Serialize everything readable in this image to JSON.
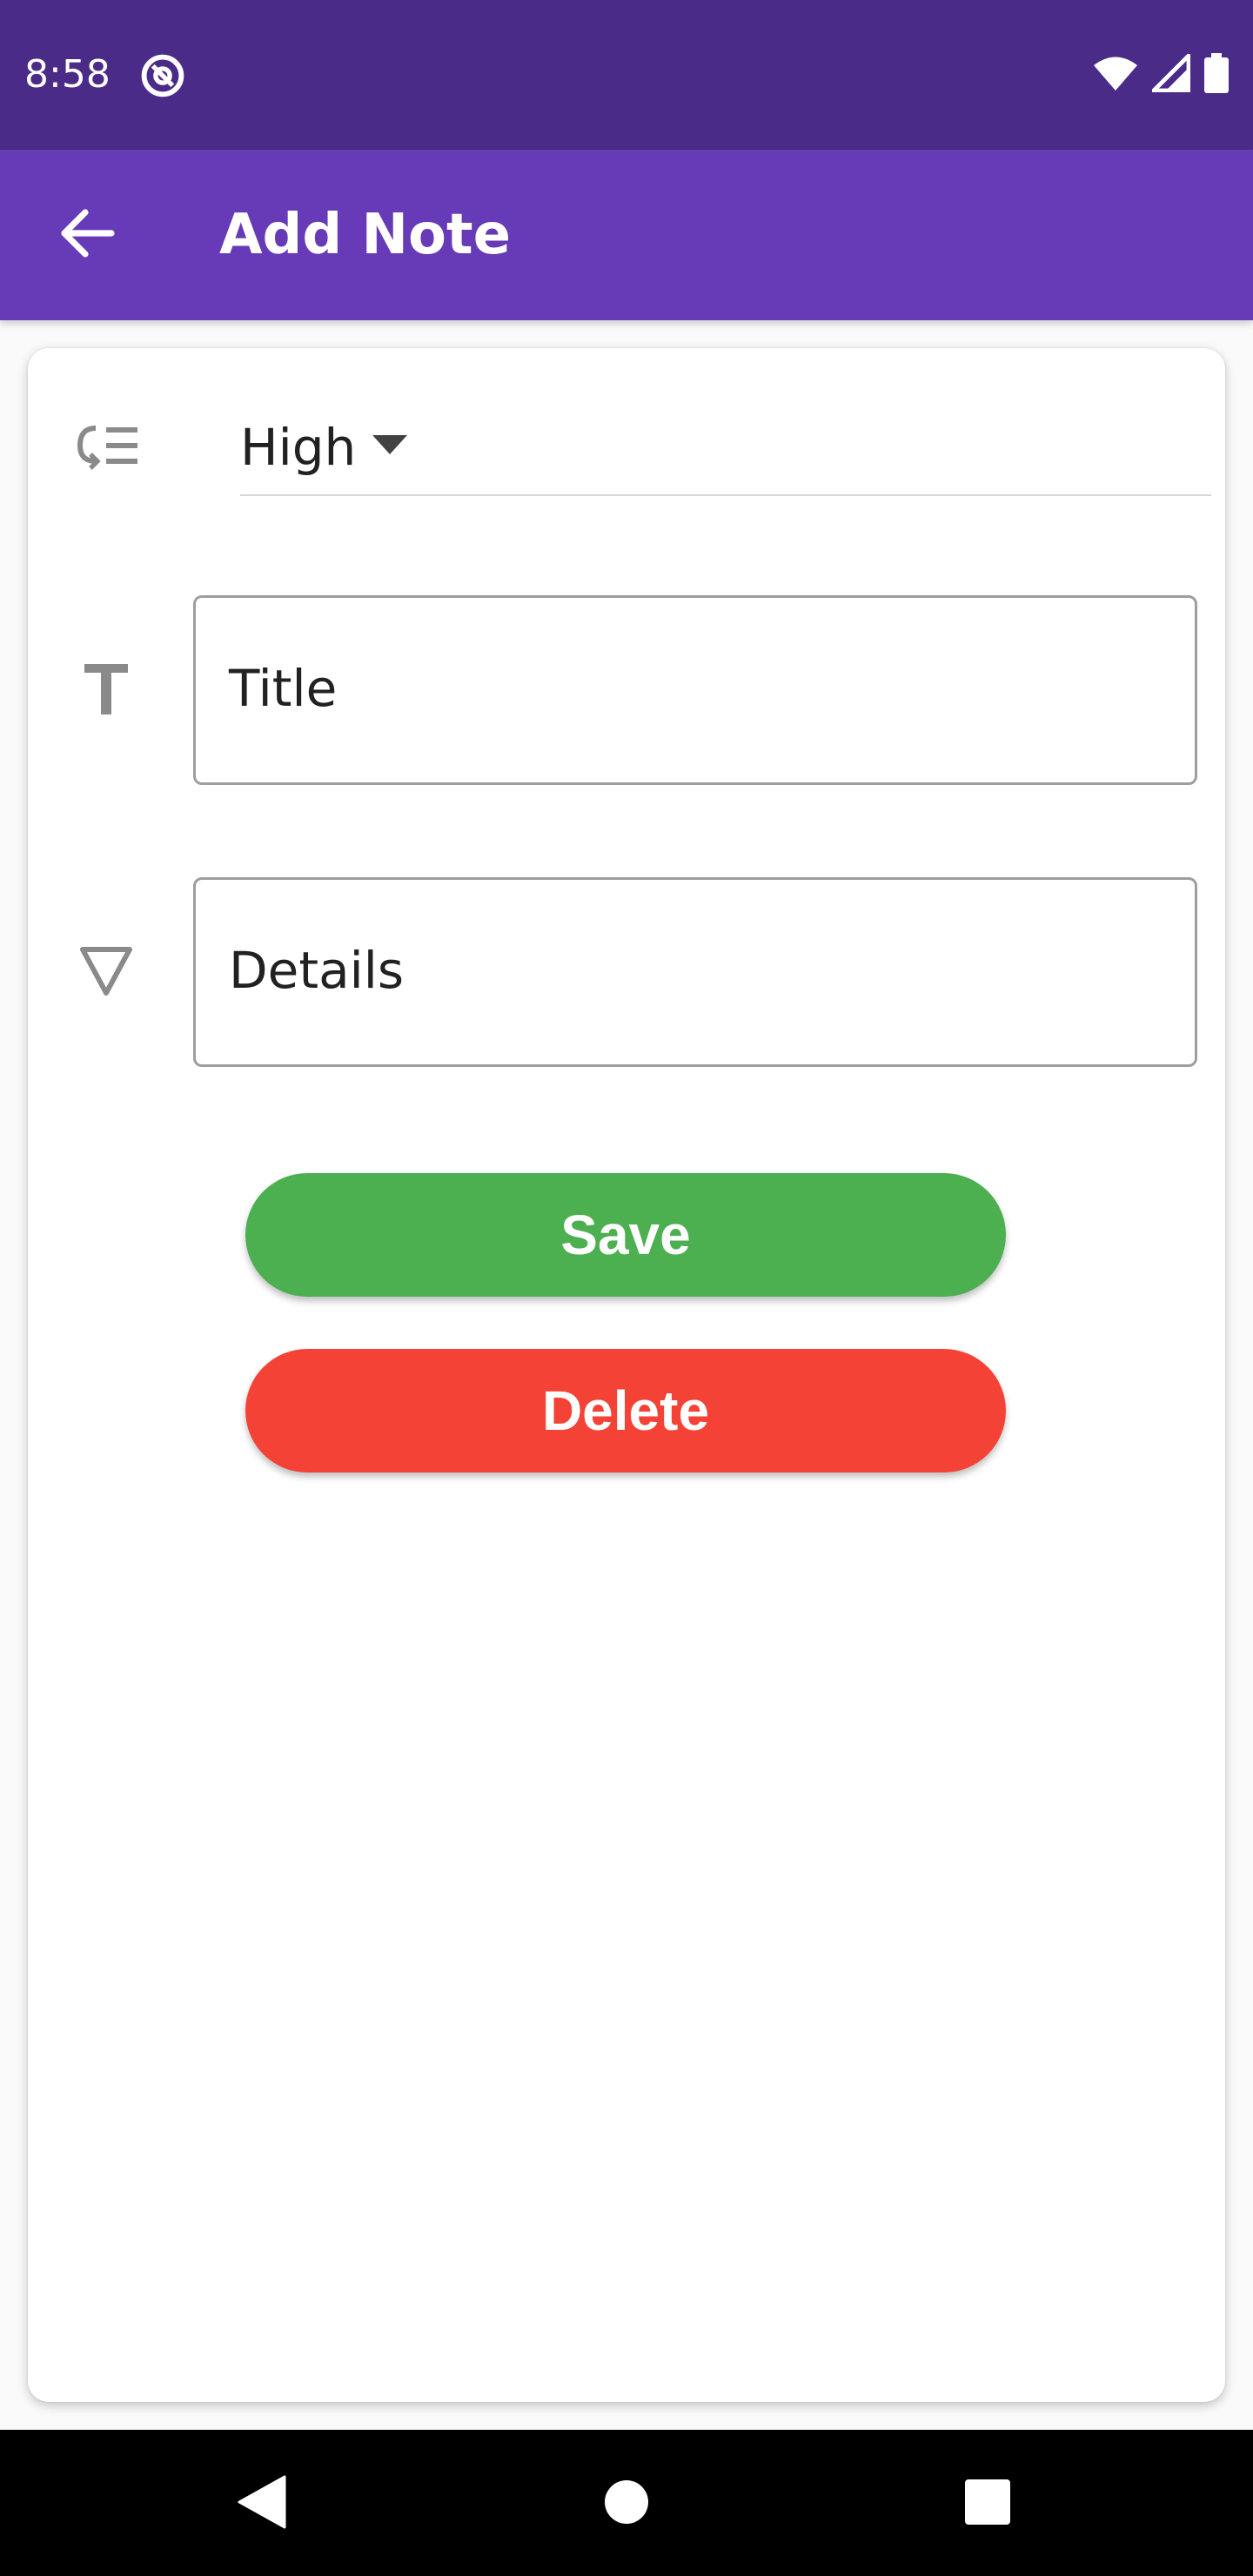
{
  "status_bar": {
    "time": "8:58",
    "icons": [
      "at-sign-icon",
      "wifi-icon",
      "signal-icon",
      "battery-icon"
    ],
    "background": "#4a2c88"
  },
  "app_bar": {
    "title": "Add Note",
    "back_icon": "arrow-back-icon",
    "background": "#673ab7"
  },
  "form": {
    "priority": {
      "icon": "priority-list-icon",
      "selected": "High",
      "dropdown_icon": "caret-down-icon"
    },
    "title_field": {
      "icon": "title-text-icon",
      "placeholder": "Title"
    },
    "details_field": {
      "icon": "details-triangle-icon",
      "placeholder": "Details"
    }
  },
  "buttons": {
    "save_label": "Save",
    "save_color": "#4caf50",
    "delete_label": "Delete",
    "delete_color": "#f44336"
  },
  "nav_bar": {
    "icons": [
      "back-triangle-icon",
      "home-circle-icon",
      "recents-square-icon"
    ]
  }
}
